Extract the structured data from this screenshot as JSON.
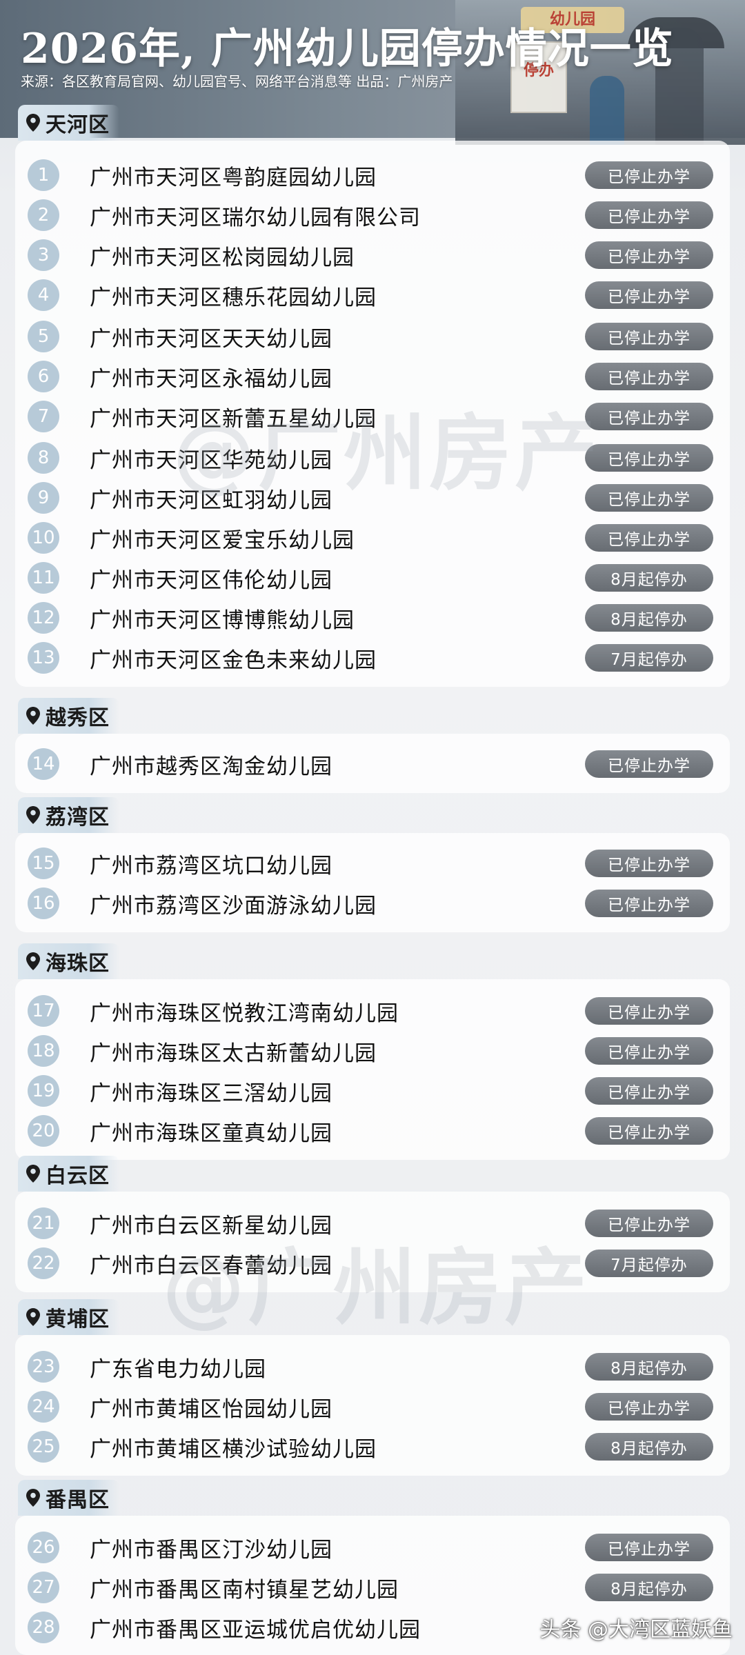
{
  "header": {
    "title": "2026年, 广州幼儿园停办情况一览",
    "source": "来源：各区教育局官网、幼儿园官号、网络平台消息等   出品：广州房产",
    "photo_sign": "幼儿园",
    "photo_board": "停办"
  },
  "watermark": "@广州房产",
  "credit": "头条 @大湾区蓝妖鱼",
  "districts": [
    {
      "name": "天河区",
      "items": [
        {
          "no": "1",
          "name": "广州市天河区粤韵庭园幼儿园",
          "status": "已停止办学"
        },
        {
          "no": "2",
          "name": "广州市天河区瑞尔幼儿园有限公司",
          "status": "已停止办学"
        },
        {
          "no": "3",
          "name": "广州市天河区松岗园幼儿园",
          "status": "已停止办学"
        },
        {
          "no": "4",
          "name": "广州市天河区穗乐花园幼儿园",
          "status": "已停止办学"
        },
        {
          "no": "5",
          "name": "广州市天河区天天幼儿园",
          "status": "已停止办学"
        },
        {
          "no": "6",
          "name": "广州市天河区永福幼儿园",
          "status": "已停止办学"
        },
        {
          "no": "7",
          "name": "广州市天河区新蕾五星幼儿园",
          "status": "已停止办学"
        },
        {
          "no": "8",
          "name": "广州市天河区华苑幼儿园",
          "status": "已停止办学"
        },
        {
          "no": "9",
          "name": "广州市天河区虹羽幼儿园",
          "status": "已停止办学"
        },
        {
          "no": "10",
          "name": "广州市天河区爱宝乐幼儿园",
          "status": "已停止办学"
        },
        {
          "no": "11",
          "name": "广州市天河区伟伦幼儿园",
          "status": "8月起停办"
        },
        {
          "no": "12",
          "name": "广州市天河区博博熊幼儿园",
          "status": "8月起停办"
        },
        {
          "no": "13",
          "name": "广州市天河区金色未来幼儿园",
          "status": "7月起停办"
        }
      ]
    },
    {
      "name": "越秀区",
      "items": [
        {
          "no": "14",
          "name": "广州市越秀区淘金幼儿园",
          "status": "已停止办学"
        }
      ]
    },
    {
      "name": "荔湾区",
      "items": [
        {
          "no": "15",
          "name": "广州市荔湾区坑口幼儿园",
          "status": "已停止办学"
        },
        {
          "no": "16",
          "name": "广州市荔湾区沙面游泳幼儿园",
          "status": "已停止办学"
        }
      ]
    },
    {
      "name": "海珠区",
      "items": [
        {
          "no": "17",
          "name": "广州市海珠区悦教江湾南幼儿园",
          "status": "已停止办学"
        },
        {
          "no": "18",
          "name": "广州市海珠区太古新蕾幼儿园",
          "status": "已停止办学"
        },
        {
          "no": "19",
          "name": "广州市海珠区三滘幼儿园",
          "status": "已停止办学"
        },
        {
          "no": "20",
          "name": "广州市海珠区童真幼儿园",
          "status": "已停止办学"
        }
      ]
    },
    {
      "name": "白云区",
      "items": [
        {
          "no": "21",
          "name": "广州市白云区新星幼儿园",
          "status": "已停止办学"
        },
        {
          "no": "22",
          "name": "广州市白云区春蕾幼儿园",
          "status": "7月起停办"
        }
      ]
    },
    {
      "name": "黄埔区",
      "items": [
        {
          "no": "23",
          "name": "广东省电力幼儿园",
          "status": "8月起停办"
        },
        {
          "no": "24",
          "name": "广州市黄埔区怡园幼儿园",
          "status": "已停止办学"
        },
        {
          "no": "25",
          "name": "广州市黄埔区横沙试验幼儿园",
          "status": "8月起停办"
        }
      ]
    },
    {
      "name": "番禺区",
      "items": [
        {
          "no": "26",
          "name": "广州市番禺区汀沙幼儿园",
          "status": "已停止办学"
        },
        {
          "no": "27",
          "name": "广州市番禺区南村镇星艺幼儿园",
          "status": "8月起停办"
        },
        {
          "no": "28",
          "name": "广州市番禺区亚运城优启优幼儿园",
          "status": ""
        }
      ]
    }
  ]
}
